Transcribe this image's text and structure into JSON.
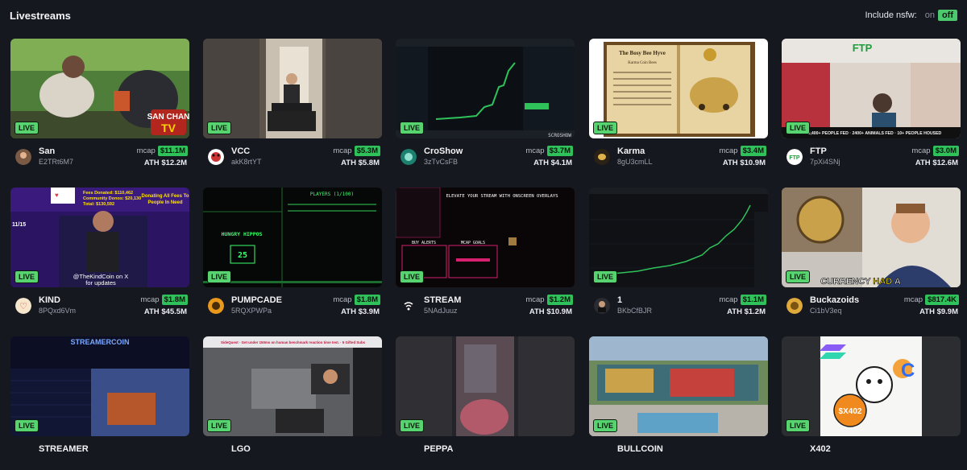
{
  "page": {
    "title": "Livestreams",
    "nsfw_label": "Include nsfw:",
    "nsfw_on": "on",
    "nsfw_off": "off"
  },
  "live_badge": "LIVE",
  "mcap_label": "mcap",
  "ath_prefix": "ATH",
  "streams": [
    {
      "name": "San",
      "address": "E2TRt6M7",
      "mcap": "$11.1M",
      "ath": "$12.2M",
      "thumb_text": [
        "SAN CHAN",
        "TV"
      ]
    },
    {
      "name": "VCC",
      "address": "akK8rtYT",
      "mcap": "$5.3M",
      "ath": "$5.8M",
      "thumb_text": []
    },
    {
      "name": "CroShow",
      "address": "3zTvCsFB",
      "mcap": "$3.7M",
      "ath": "$4.1M",
      "thumb_text": [
        "SCROSHOW"
      ]
    },
    {
      "name": "Karma",
      "address": "8gU3cmLL",
      "mcap": "$3.4M",
      "ath": "$10.9M",
      "thumb_text": [
        "The Bosy Bee Hyve",
        "Karma Coin Bees"
      ]
    },
    {
      "name": "FTP",
      "address": "7pXi4SNj",
      "mcap": "$3.0M",
      "ath": "$12.6M",
      "thumb_text": [
        "FTP",
        "10,400+ PEOPLE FED · 2400+ ANIMALS FED · 10+ PEOPLE HOUSED"
      ]
    },
    {
      "name": "KIND",
      "address": "8PQxd6Vm",
      "mcap": "$1.8M",
      "ath": "$45.5M",
      "thumb_text": [
        "Fees Donated: $110,462",
        "Community Donos: $20,130",
        "Total: $130,592",
        "Donating All Fees To",
        "People In Need",
        "11/15",
        "@TheKindCoin on X",
        "for updates"
      ]
    },
    {
      "name": "PUMPCADE",
      "address": "5RQXPWPa",
      "mcap": "$1.8M",
      "ath": "$3.9M",
      "thumb_text": [
        "PLAYERS (1/100)",
        "HUNGRY HIPPOS",
        "25"
      ]
    },
    {
      "name": "STREAM",
      "address": "5NAdJuuz",
      "mcap": "$1.2M",
      "ath": "$10.9M",
      "thumb_text": [
        "ELEVATE YOUR STREAM WITH ONSCREEN OVERLAYS",
        "BUY ALERTS",
        "MCAP GOALS"
      ]
    },
    {
      "name": "1",
      "address": "BKbCfBJR",
      "mcap": "$1.1M",
      "ath": "$1.2M",
      "thumb_text": []
    },
    {
      "name": "Buckazoids",
      "address": "Ci1bV3eq",
      "mcap": "$817.4K",
      "ath": "$9.9M",
      "thumb_text": [
        "CURRENCY",
        "HAD",
        "A"
      ]
    },
    {
      "name": "STREAMER",
      "address": "",
      "mcap": "",
      "ath": "",
      "thumb_text": [
        "STREAMERCOIN"
      ]
    },
    {
      "name": "LGO",
      "address": "",
      "mcap": "",
      "ath": "",
      "thumb_text": [
        "SideQuest · Get under 150ms on human benchmark reaction time test. · 5 Gifted Subs"
      ]
    },
    {
      "name": "PEPPA",
      "address": "",
      "mcap": "",
      "ath": "",
      "thumb_text": []
    },
    {
      "name": "BULLCOIN",
      "address": "",
      "mcap": "",
      "ath": "",
      "thumb_text": []
    },
    {
      "name": "X402",
      "address": "",
      "mcap": "",
      "ath": "",
      "thumb_text": [
        "$X402"
      ]
    }
  ],
  "colors": {
    "background": "#16181f",
    "live_badge": "#57d36f",
    "mcap_badge": "#2fc25b",
    "nsfw_off": "#4cc96f"
  },
  "icons": [
    "san-avatar",
    "vcc-dog-avatar",
    "croshow-avatar",
    "karma-bee-avatar",
    "ftp-logo-avatar",
    "kind-heart-avatar",
    "pumpcade-avatar",
    "stream-avatar",
    "one-avatar",
    "buckazoids-avatar"
  ]
}
